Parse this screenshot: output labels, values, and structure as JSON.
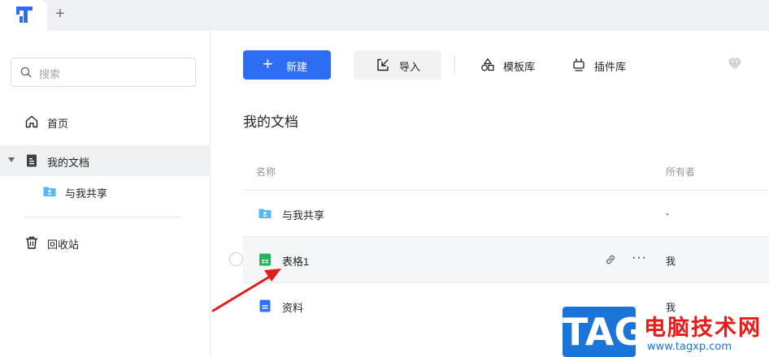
{
  "tabs": {
    "add_label": "+"
  },
  "sidebar": {
    "search_placeholder": "搜索",
    "items": [
      {
        "label": "首页"
      },
      {
        "label": "我的文档"
      },
      {
        "label": "与我共享"
      },
      {
        "label": "回收站"
      }
    ]
  },
  "toolbar": {
    "new_plus": "+",
    "new_label": "新建",
    "import_label": "导入",
    "template_label": "模板库",
    "plugin_label": "插件库"
  },
  "main": {
    "title": "我的文档",
    "columns": {
      "name": "名称",
      "owner": "所有者"
    },
    "rows": [
      {
        "name": "与我共享",
        "owner": "-"
      },
      {
        "name": "表格1",
        "owner": "我"
      },
      {
        "name": "资料",
        "owner": "我"
      }
    ],
    "more_glyph": "···"
  },
  "watermark": {
    "tag": "TAG",
    "cn": "电脑技术网",
    "url": "www.tagxp.com"
  },
  "colors": {
    "accent": "#2f6cf6",
    "folder": "#5bb6f5",
    "sheet": "#21b45b",
    "doc": "#3370ff",
    "annotation_arrow": "#e11d1d"
  }
}
